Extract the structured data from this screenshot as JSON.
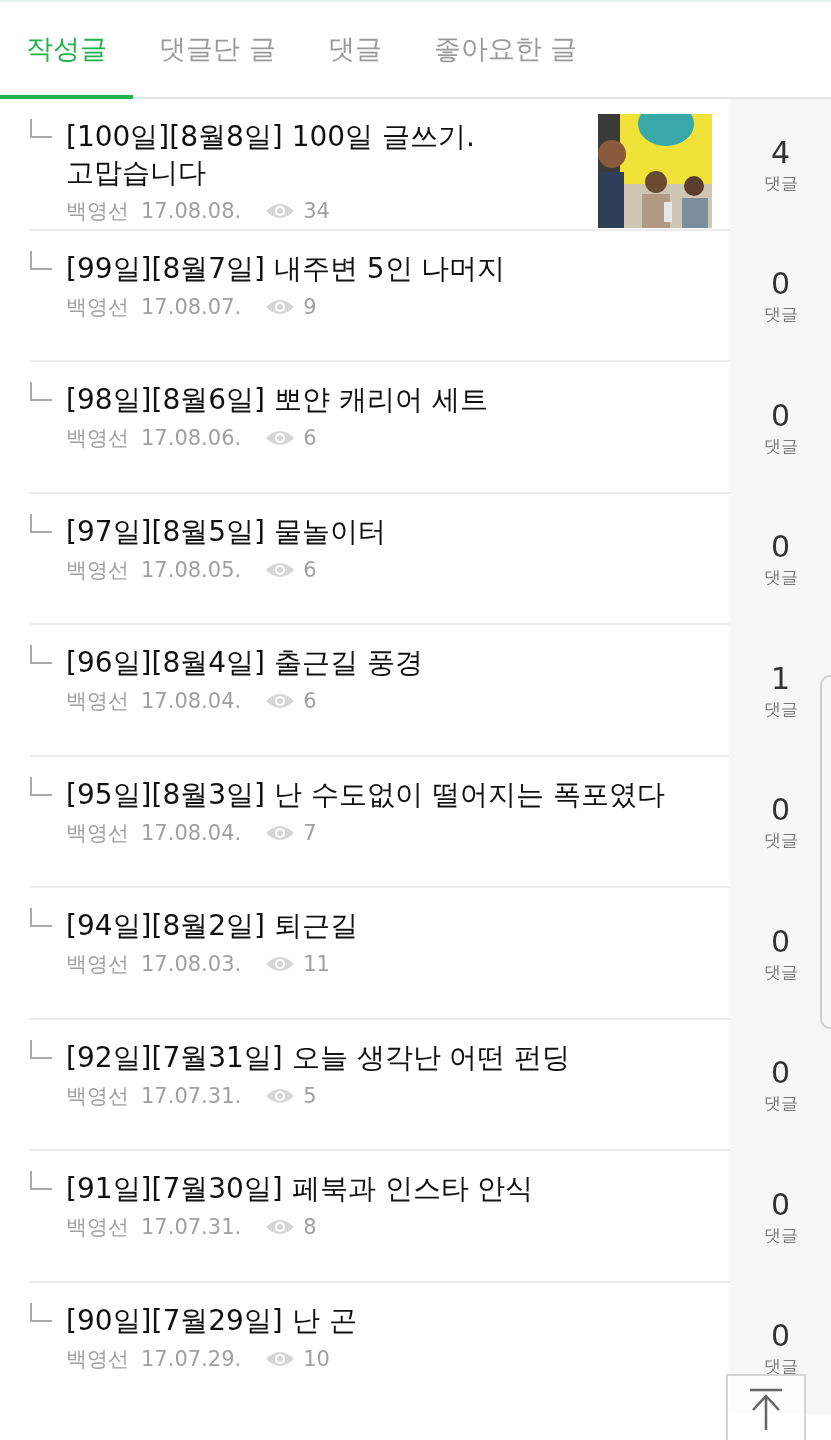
{
  "tabs": [
    {
      "label": "작성글",
      "selected": true
    },
    {
      "label": "댓글단 글",
      "selected": false
    },
    {
      "label": "댓글",
      "selected": false
    },
    {
      "label": "좋아요한 글",
      "selected": false
    }
  ],
  "posts": [
    {
      "title": "[100일][8월8일] 100일 글쓰기.\n고맙습니다",
      "author": "백영선",
      "date": "17.08.08.",
      "views": "34",
      "comments": "4",
      "comment_label": "댓글"
    },
    {
      "title": "[99일][8월7일] 내주변 5인 나머지",
      "author": "백영선",
      "date": "17.08.07.",
      "views": "9",
      "comments": "0",
      "comment_label": "댓글"
    },
    {
      "title": "[98일][8월6일] 뽀얀 캐리어 세트",
      "author": "백영선",
      "date": "17.08.06.",
      "views": "6",
      "comments": "0",
      "comment_label": "댓글"
    },
    {
      "title": "[97일][8월5일] 물놀이터",
      "author": "백영선",
      "date": "17.08.05.",
      "views": "6",
      "comments": "0",
      "comment_label": "댓글"
    },
    {
      "title": "[96일][8월4일] 출근길 풍경",
      "author": "백영선",
      "date": "17.08.04.",
      "views": "6",
      "comments": "1",
      "comment_label": "댓글"
    },
    {
      "title": "[95일][8월3일] 난 수도없이 떨어지는 폭포였다",
      "author": "백영선",
      "date": "17.08.04.",
      "views": "7",
      "comments": "0",
      "comment_label": "댓글"
    },
    {
      "title": "[94일][8월2일] 퇴근길",
      "author": "백영선",
      "date": "17.08.03.",
      "views": "11",
      "comments": "0",
      "comment_label": "댓글"
    },
    {
      "title": "[92일][7월31일] 오늘 생각난 어떤 펀딩",
      "author": "백영선",
      "date": "17.07.31.",
      "views": "5",
      "comments": "0",
      "comment_label": "댓글"
    },
    {
      "title": "[91일][7월30일] 페북과 인스타 안식",
      "author": "백영선",
      "date": "17.07.31.",
      "views": "8",
      "comments": "0",
      "comment_label": "댓글"
    },
    {
      "title": "[90일][7월29일] 난 곤",
      "author": "백영선",
      "date": "17.07.29.",
      "views": "10",
      "comments": "0",
      "comment_label": "댓글"
    }
  ]
}
